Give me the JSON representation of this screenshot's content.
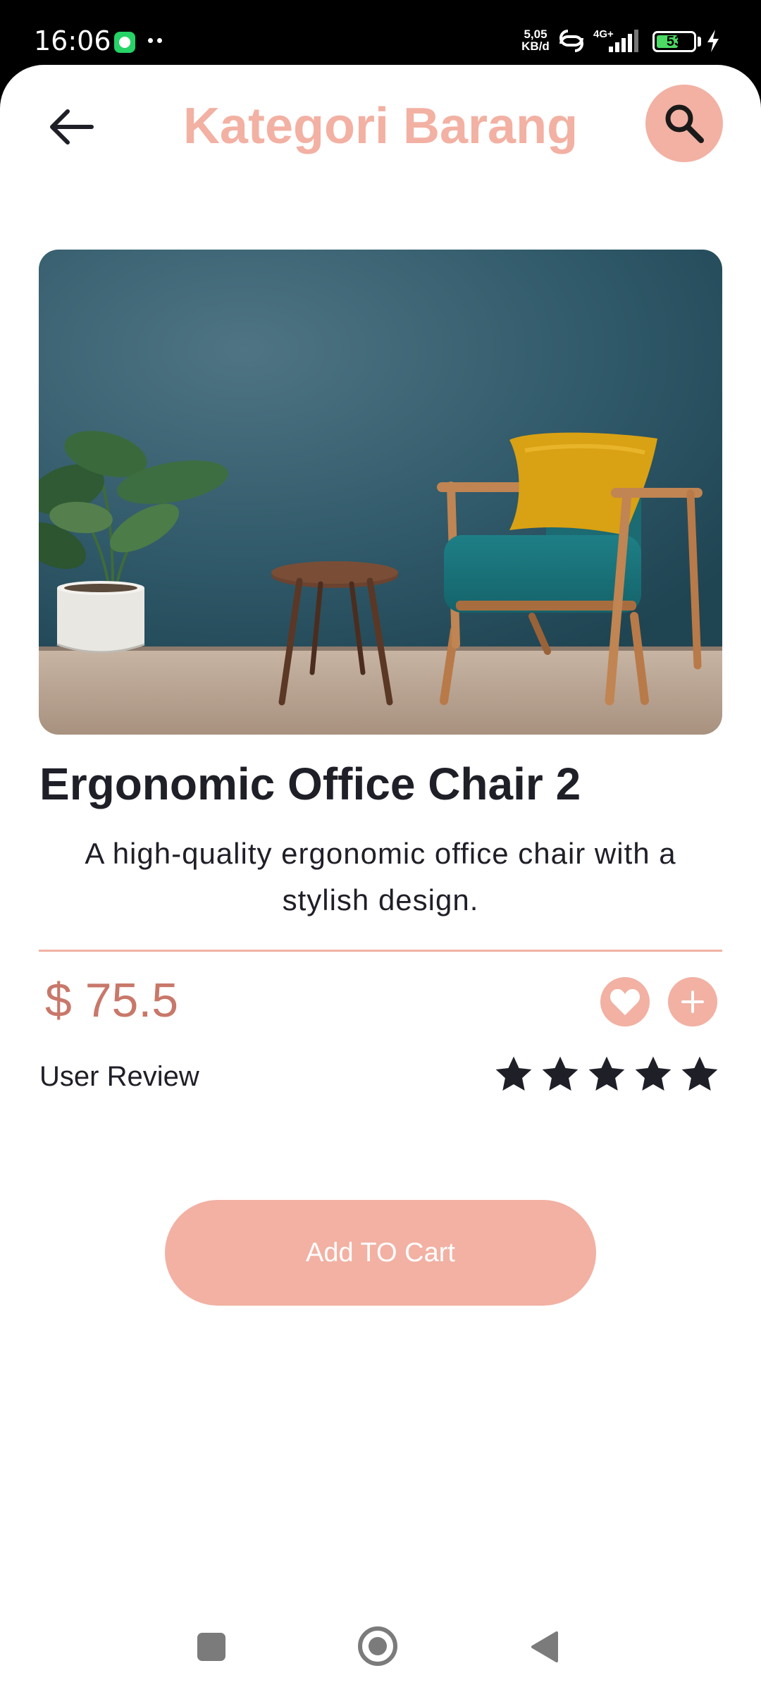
{
  "status_bar": {
    "time": "16:06",
    "net_speed": "5,05",
    "net_speed_unit": "KB/d",
    "network_type": "4G+",
    "battery": "53",
    "battery_level": 0.53,
    "icons": [
      "whatsapp-icon",
      "more-dots-icon",
      "hotspot-icon",
      "signal-icon",
      "battery-icon",
      "charging-bolt-icon"
    ]
  },
  "header": {
    "title": "Kategori Barang",
    "back_icon": "arrow-left-icon",
    "search_icon": "search-icon"
  },
  "product": {
    "image": "armchair-living-room-photo",
    "name": "Ergonomic Office Chair 2",
    "description": "A high-quality ergonomic office chair with a stylish design.",
    "price": "$ 75.5",
    "review_label": "User Review",
    "rating": 5,
    "rating_max": 5
  },
  "actions": {
    "favorite_icon": "heart-icon",
    "add_icon": "plus-icon",
    "cart_label": "Add TO Cart"
  },
  "nav_bar": {
    "icons": [
      "recents-square-icon",
      "home-circle-icon",
      "back-triangle-icon"
    ]
  },
  "colors": {
    "accent": "#f2b1a3",
    "price": "#c8786a",
    "text": "#1f1f28"
  }
}
